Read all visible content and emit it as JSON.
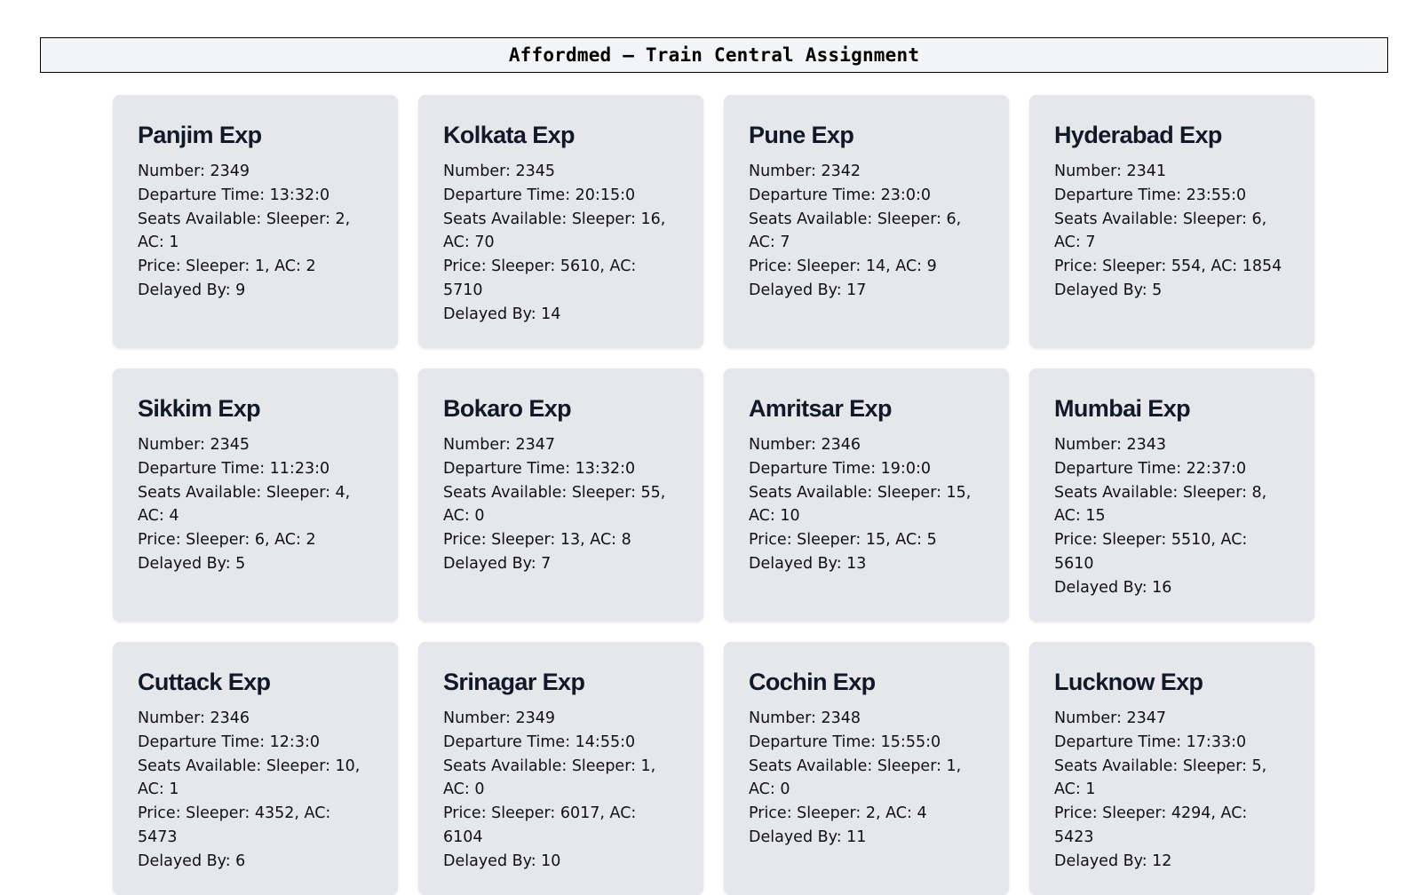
{
  "header": {
    "title": "Affordmed – Train Central Assignment"
  },
  "labels": {
    "number": "Number: ",
    "departure": "Departure Time: ",
    "seats": "Seats Available: ",
    "price": "Price: ",
    "delay": "Delayed By: "
  },
  "trains": [
    {
      "name": "Panjim Exp",
      "number": "2349",
      "departure": "13:32:0",
      "seats": "Sleeper: 2, AC: 1",
      "price": "Sleeper: 1, AC: 2",
      "delay": "9"
    },
    {
      "name": "Kolkata Exp",
      "number": "2345",
      "departure": "20:15:0",
      "seats": "Sleeper: 16, AC: 70",
      "price": "Sleeper: 5610, AC: 5710",
      "delay": "14"
    },
    {
      "name": "Pune Exp",
      "number": "2342",
      "departure": "23:0:0",
      "seats": "Sleeper: 6, AC: 7",
      "price": "Sleeper: 14, AC: 9",
      "delay": "17"
    },
    {
      "name": "Hyderabad Exp",
      "number": "2341",
      "departure": "23:55:0",
      "seats": "Sleeper: 6, AC: 7",
      "price": "Sleeper: 554, AC: 1854",
      "delay": "5"
    },
    {
      "name": "Sikkim Exp",
      "number": "2345",
      "departure": "11:23:0",
      "seats": "Sleeper: 4, AC: 4",
      "price": "Sleeper: 6, AC: 2",
      "delay": "5"
    },
    {
      "name": "Bokaro Exp",
      "number": "2347",
      "departure": "13:32:0",
      "seats": "Sleeper: 55, AC: 0",
      "price": "Sleeper: 13, AC: 8",
      "delay": "7"
    },
    {
      "name": "Amritsar Exp",
      "number": "2346",
      "departure": "19:0:0",
      "seats": "Sleeper: 15, AC: 10",
      "price": "Sleeper: 15, AC: 5",
      "delay": "13"
    },
    {
      "name": "Mumbai Exp",
      "number": "2343",
      "departure": "22:37:0",
      "seats": "Sleeper: 8, AC: 15",
      "price": "Sleeper: 5510, AC: 5610",
      "delay": "16"
    },
    {
      "name": "Cuttack Exp",
      "number": "2346",
      "departure": "12:3:0",
      "seats": "Sleeper: 10, AC: 1",
      "price": "Sleeper: 4352, AC: 5473",
      "delay": "6"
    },
    {
      "name": "Srinagar Exp",
      "number": "2349",
      "departure": "14:55:0",
      "seats": "Sleeper: 1, AC: 0",
      "price": "Sleeper: 6017, AC: 6104",
      "delay": "10"
    },
    {
      "name": "Cochin Exp",
      "number": "2348",
      "departure": "15:55:0",
      "seats": "Sleeper: 1, AC: 0",
      "price": "Sleeper: 2, AC: 4",
      "delay": "11"
    },
    {
      "name": "Lucknow Exp",
      "number": "2347",
      "departure": "17:33:0",
      "seats": "Sleeper: 5, AC: 1",
      "price": "Sleeper: 4294, AC: 5423",
      "delay": "12"
    }
  ]
}
